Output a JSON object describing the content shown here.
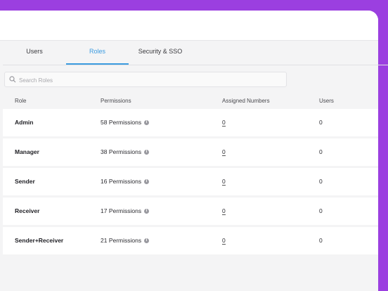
{
  "tabs": [
    {
      "label": "Users",
      "active": false
    },
    {
      "label": "Roles",
      "active": true
    },
    {
      "label": "Security & SSO",
      "active": false
    }
  ],
  "search": {
    "placeholder": "Search Roles",
    "value": ""
  },
  "columns": {
    "role": "Role",
    "permissions": "Permissions",
    "assigned": "Assigned Numbers",
    "users": "Users"
  },
  "rows": [
    {
      "role": "Admin",
      "permissions": "58 Permissions",
      "assigned": "0",
      "users": "0"
    },
    {
      "role": "Manager",
      "permissions": "38 Permissions",
      "assigned": "0",
      "users": "0"
    },
    {
      "role": "Sender",
      "permissions": "16 Permissions",
      "assigned": "0",
      "users": "0"
    },
    {
      "role": "Receiver",
      "permissions": "17 Permissions",
      "assigned": "0",
      "users": "0"
    },
    {
      "role": "Sender+Receiver",
      "permissions": "21 Permissions",
      "assigned": "0",
      "users": "0"
    }
  ],
  "colors": {
    "accent": "#3b9be0",
    "frame": "#9b3fe0"
  }
}
